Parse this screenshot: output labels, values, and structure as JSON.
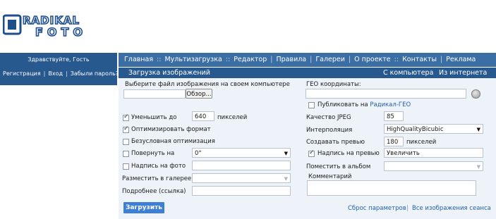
{
  "logo": {
    "text_top": "RADIKAL",
    "text_bottom": "FOTO",
    "colors": {
      "blue": "#1f4e8c",
      "light": "#7fa8d6"
    }
  },
  "sidebar": {
    "greeting": "Здравствуйте, Гость",
    "links": [
      "Регистрация",
      "Вход",
      "Забыли пароль?"
    ]
  },
  "nav": {
    "items": [
      "Главная",
      "Мультизагрузка",
      "Редактор",
      "Правила",
      "Галереи",
      "О проекте",
      "Контакты",
      "Реклама"
    ]
  },
  "section": {
    "title": "Загрузка изображений",
    "tabs": [
      "С компьютера",
      "Из интернета"
    ]
  },
  "form": {
    "file_label": "Выберите файл изображения на своем компьютере",
    "browse_label": "Обзор...",
    "geo_label": "ГЕО координаты:",
    "geo_value": "",
    "publish_label": "Публиковать на",
    "publish_link": "Радикал-ГЕО",
    "publish_checked": false,
    "reduce_label": "Уменьшить до",
    "reduce_value": "640",
    "reduce_unit": "пикселей",
    "reduce_checked": true,
    "optimize_label": "Оптимизировать формат",
    "optimize_checked": true,
    "unconditional_label": "Безусловная оптимизация",
    "unconditional_checked": false,
    "rotate_label": "Повернуть на",
    "rotate_value": "0°",
    "rotate_checked": false,
    "caption_label": "Надпись на фото",
    "caption_value": "",
    "caption_checked": false,
    "gallery_label": "Разместить в галерее",
    "gallery_value": "",
    "details_label": "Подробнее (ссылка)",
    "details_value": "",
    "jpeg_label": "Качество JPEG",
    "jpeg_value": "85",
    "interp_label": "Интерполяция",
    "interp_value": "HighQualityBicubic",
    "preview_label": "Создавать превью",
    "preview_value": "180",
    "preview_unit": "пикселей",
    "preview_caption_label": "Надпись на превью",
    "preview_caption_value": "Увеличить",
    "preview_caption_checked": true,
    "album_label": "Поместить в альбом",
    "album_value": "",
    "comment_label": "Комментарий",
    "comment_value": "",
    "upload_label": "Загрузить",
    "reset_link": "Сброс параметров",
    "session_link": "Все изображения сеанса"
  },
  "colors": {
    "nav": "#3a6ea5",
    "dark_bar": "#27598f",
    "panel": "#eef3f9",
    "button": "#3d7fd6",
    "link": "#1f5fae"
  }
}
